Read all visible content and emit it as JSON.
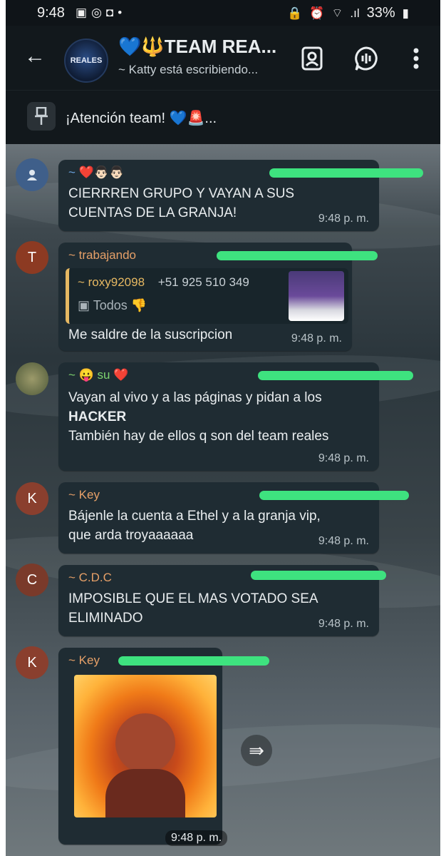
{
  "status_bar": {
    "time": "9:48",
    "battery": "33%"
  },
  "header": {
    "group_name": "💙🔱TEAM REA...",
    "subtitle": "~ Katty está escribiendo...",
    "avatar_text": "REALES"
  },
  "pinned": {
    "text": "¡Atención team! 💙🚨..."
  },
  "messages": [
    {
      "sender": "~ ❤️👨🏻👨🏻",
      "avatar": "",
      "lines": [
        "CIERRREN GRUPO Y VAYAN A SUS",
        "CUENTAS DE LA GRANJA!"
      ],
      "time": "9:48 p. m."
    },
    {
      "sender": "~ trabajando",
      "avatar": "T",
      "quote": {
        "name": "~ roxy92098",
        "phone": "+51 925 510 349",
        "text": "Todos 👎"
      },
      "lines": [
        "Me saldre de la suscripcion"
      ],
      "time": "9:48 p. m."
    },
    {
      "sender": "~ 😛 su ❤️",
      "avatar": "",
      "lines": [
        "Vayan al vivo y a las páginas y pidan a los",
        "HACKER",
        "También hay de ellos q son del team reales"
      ],
      "time": "9:48 p. m."
    },
    {
      "sender": "~ Key",
      "avatar": "K",
      "lines": [
        "Bájenle la cuenta a Ethel y a la granja vip,",
        "que arda troyaaaaaa"
      ],
      "time": "9:48 p. m."
    },
    {
      "sender": "~ C.D.C",
      "avatar": "C",
      "lines": [
        "IMPOSIBLE QUE EL MAS VOTADO SEA",
        "ELIMINADO"
      ],
      "time": "9:48 p. m."
    },
    {
      "sender": "~ Key",
      "avatar": "K",
      "time": "9:48 p. m."
    }
  ],
  "colors": {
    "bubble": "#1f2c33",
    "redaction": "#3ee27f",
    "sender_orange": "#e6a068",
    "sender_green": "#7ed46f",
    "sender_blue": "#6ea8e6",
    "avatar_k": "#8a3f2e",
    "avatar_t": "#8c3a22",
    "avatar_c": "#7a3a2a"
  }
}
